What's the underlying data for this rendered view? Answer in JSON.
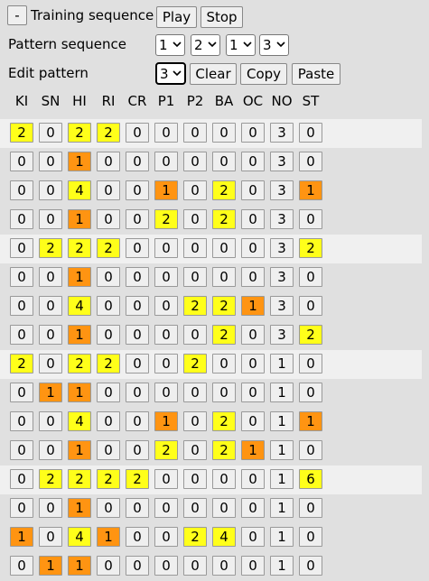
{
  "header": {
    "toggle_label": "-",
    "training_label": "Training sequence",
    "play_label": "Play",
    "stop_label": "Stop",
    "pattern_sequence_label": "Pattern sequence",
    "pattern_sequence_values": [
      "1",
      "2",
      "1",
      "3"
    ],
    "edit_pattern_label": "Edit pattern",
    "edit_pattern_value": "3",
    "clear_label": "Clear",
    "copy_label": "Copy",
    "paste_label": "Paste"
  },
  "columns": [
    "KI",
    "SN",
    "HI",
    "RI",
    "CR",
    "P1",
    "P2",
    "BA",
    "OC",
    "NO",
    "ST"
  ],
  "colors": {
    "level1": "#ff9412",
    "level2": "#ffff1a",
    "level0": "#efefef",
    "highlight_row": "#f0f0f0"
  },
  "rows": [
    [
      "2",
      "0",
      "2",
      "2",
      "0",
      "0",
      "0",
      "0",
      "0",
      "3",
      "0"
    ],
    [
      "0",
      "0",
      "1",
      "0",
      "0",
      "0",
      "0",
      "0",
      "0",
      "3",
      "0"
    ],
    [
      "0",
      "0",
      "4",
      "0",
      "0",
      "1",
      "0",
      "2",
      "0",
      "3",
      "1"
    ],
    [
      "0",
      "0",
      "1",
      "0",
      "0",
      "2",
      "0",
      "2",
      "0",
      "3",
      "0"
    ],
    [
      "0",
      "2",
      "2",
      "2",
      "0",
      "0",
      "0",
      "0",
      "0",
      "3",
      "2"
    ],
    [
      "0",
      "0",
      "1",
      "0",
      "0",
      "0",
      "0",
      "0",
      "0",
      "3",
      "0"
    ],
    [
      "0",
      "0",
      "4",
      "0",
      "0",
      "0",
      "2",
      "2",
      "1",
      "3",
      "0"
    ],
    [
      "0",
      "0",
      "1",
      "0",
      "0",
      "0",
      "0",
      "2",
      "0",
      "3",
      "2"
    ],
    [
      "2",
      "0",
      "2",
      "2",
      "0",
      "0",
      "2",
      "0",
      "0",
      "1",
      "0"
    ],
    [
      "0",
      "1",
      "1",
      "0",
      "0",
      "0",
      "0",
      "0",
      "0",
      "1",
      "0"
    ],
    [
      "0",
      "0",
      "4",
      "0",
      "0",
      "1",
      "0",
      "2",
      "0",
      "1",
      "1"
    ],
    [
      "0",
      "0",
      "1",
      "0",
      "0",
      "2",
      "0",
      "2",
      "1",
      "1",
      "0"
    ],
    [
      "0",
      "2",
      "2",
      "2",
      "2",
      "0",
      "0",
      "0",
      "0",
      "1",
      "6"
    ],
    [
      "0",
      "0",
      "1",
      "0",
      "0",
      "0",
      "0",
      "0",
      "0",
      "1",
      "0"
    ],
    [
      "1",
      "0",
      "4",
      "1",
      "0",
      "0",
      "2",
      "4",
      "0",
      "1",
      "0"
    ],
    [
      "0",
      "1",
      "1",
      "0",
      "0",
      "0",
      "0",
      "0",
      "0",
      "1",
      "0"
    ]
  ],
  "cell_level": [
    [
      2,
      0,
      2,
      2,
      0,
      0,
      0,
      0,
      0,
      0,
      0
    ],
    [
      0,
      0,
      1,
      0,
      0,
      0,
      0,
      0,
      0,
      0,
      0
    ],
    [
      0,
      0,
      2,
      0,
      0,
      1,
      0,
      2,
      0,
      0,
      1
    ],
    [
      0,
      0,
      1,
      0,
      0,
      2,
      0,
      2,
      0,
      0,
      0
    ],
    [
      0,
      2,
      2,
      2,
      0,
      0,
      0,
      0,
      0,
      0,
      2
    ],
    [
      0,
      0,
      1,
      0,
      0,
      0,
      0,
      0,
      0,
      0,
      0
    ],
    [
      0,
      0,
      2,
      0,
      0,
      0,
      2,
      2,
      1,
      0,
      0
    ],
    [
      0,
      0,
      1,
      0,
      0,
      0,
      0,
      2,
      0,
      0,
      2
    ],
    [
      2,
      0,
      2,
      2,
      0,
      0,
      2,
      0,
      0,
      0,
      0
    ],
    [
      0,
      1,
      1,
      0,
      0,
      0,
      0,
      0,
      0,
      0,
      0
    ],
    [
      0,
      0,
      2,
      0,
      0,
      1,
      0,
      2,
      0,
      0,
      1
    ],
    [
      0,
      0,
      1,
      0,
      0,
      2,
      0,
      2,
      1,
      0,
      0
    ],
    [
      0,
      2,
      2,
      2,
      2,
      0,
      0,
      0,
      0,
      0,
      2
    ],
    [
      0,
      0,
      1,
      0,
      0,
      0,
      0,
      0,
      0,
      0,
      0
    ],
    [
      1,
      0,
      2,
      1,
      0,
      0,
      2,
      2,
      0,
      0,
      0
    ],
    [
      0,
      1,
      1,
      0,
      0,
      0,
      0,
      0,
      0,
      0,
      0
    ]
  ],
  "highlight_rows": [
    0,
    4,
    8,
    12
  ]
}
